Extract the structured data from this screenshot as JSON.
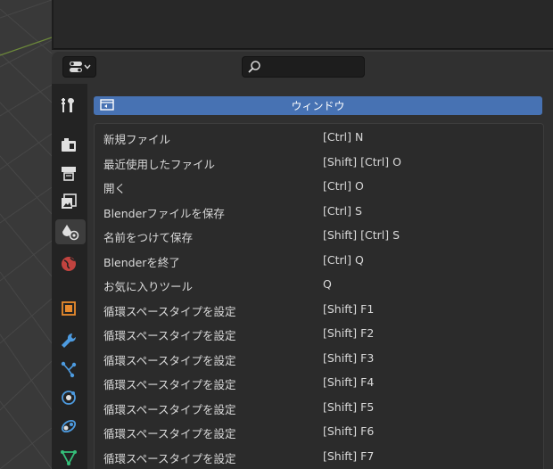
{
  "header": {
    "search_placeholder": ""
  },
  "tabs": [
    {
      "name": "tool"
    },
    {
      "name": "render"
    },
    {
      "name": "output"
    },
    {
      "name": "view-layer"
    },
    {
      "name": "scene"
    },
    {
      "name": "world"
    },
    {
      "name": "object"
    },
    {
      "name": "modifiers"
    },
    {
      "name": "particles"
    },
    {
      "name": "physics"
    },
    {
      "name": "constraints"
    },
    {
      "name": "data"
    }
  ],
  "panel": {
    "title": "ウィンドウ",
    "rows": [
      {
        "name": "新規ファイル",
        "key": "[Ctrl] N"
      },
      {
        "name": "最近使用したファイル",
        "key": "[Shift] [Ctrl] O"
      },
      {
        "name": "開く",
        "key": "[Ctrl] O"
      },
      {
        "name": "Blenderファイルを保存",
        "key": "[Ctrl] S"
      },
      {
        "name": "名前をつけて保存",
        "key": "[Shift] [Ctrl] S"
      },
      {
        "name": "Blenderを終了",
        "key": "[Ctrl] Q"
      },
      {
        "name": "お気に入りツール",
        "key": "Q"
      },
      {
        "name": "循環スペースタイプを設定",
        "key": "[Shift] F1"
      },
      {
        "name": "循環スペースタイプを設定",
        "key": "[Shift] F2"
      },
      {
        "name": "循環スペースタイプを設定",
        "key": "[Shift] F3"
      },
      {
        "name": "循環スペースタイプを設定",
        "key": "[Shift] F4"
      },
      {
        "name": "循環スペースタイプを設定",
        "key": "[Shift] F5"
      },
      {
        "name": "循環スペースタイプを設定",
        "key": "[Shift] F6"
      },
      {
        "name": "循環スペースタイプを設定",
        "key": "[Shift] F7"
      }
    ]
  },
  "colors": {
    "accent": "#4772b3",
    "background": "#303030",
    "tabs_bg": "#232323"
  }
}
